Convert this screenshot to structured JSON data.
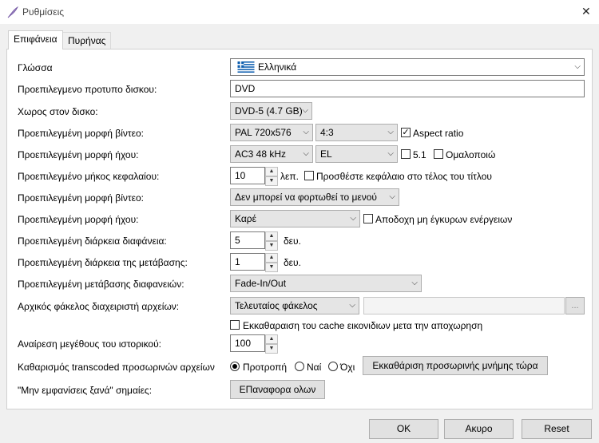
{
  "window": {
    "title": "Ρυθμίσεις",
    "close_label": "✕"
  },
  "tabs": [
    {
      "label": "Επιφάνεια"
    },
    {
      "label": "Πυρήνας"
    }
  ],
  "rows": {
    "language": {
      "label": "Γλώσσα",
      "value": "Ελληνικά"
    },
    "disc_template": {
      "label": "Προεπιλεγμενο προτυπο δισκου:",
      "value": "DVD"
    },
    "disc_space": {
      "label": "Χωρος στον δισκο:",
      "value": "DVD-5 (4.7 GB)"
    },
    "video_format": {
      "label": "Προεπιλεγμένη μορφή βίντεο:",
      "value": "PAL 720x576",
      "aspect_value": "4:3",
      "aspect_ratio_label": "Aspect ratio",
      "aspect_ratio_checked": true
    },
    "audio_format": {
      "label": "Προεπιλεγμένη μορφή ήχου:",
      "value": "AC3 48 kHz",
      "lang_value": "EL",
      "surround_label": "5.1",
      "normalize_label": "Ομαλοποιώ"
    },
    "chapter_length": {
      "label": "Προεπιλεγμένο μήκος κεφαλαίου:",
      "value": "10",
      "unit": "λεπ.",
      "add_chapter_label": "Προσθέστε κεφάλαιο στο τέλος του τίτλου"
    },
    "menu_video_format": {
      "label": "Προεπιλεγμένη μορφή βίντεο:",
      "value": "Δεν μπορεί να φορτωθεί το μενού"
    },
    "menu_audio_format": {
      "label": "Προεπιλεγμένη μορφή ήχου:",
      "value": "Καρέ",
      "accept_invalid_label": "Αποδοχη μη έγκυρων ενέργειων"
    },
    "slide_duration": {
      "label": "Προεπιλεγμένη διάρκεια διαφάνεια:",
      "value": "5",
      "unit": "δευ."
    },
    "transition_duration": {
      "label": "Προεπιλεγμένη διάρκεια της μετάβασης:",
      "value": "1",
      "unit": "δευ."
    },
    "slide_transition": {
      "label": "Προεπιλεγμένη μετάβασης διαφανειών:",
      "value": "Fade-In/Out"
    },
    "file_manager_folder": {
      "label": "Αρχικός φάκελος διαχειριστή αρχείων:",
      "value": "Τελευταίος φάκελος",
      "path_value": "",
      "browse_label": "..."
    },
    "clear_cache": {
      "label": "Εκκαθαραιση του cache εικονιδιων μετα την αποχωρηση"
    },
    "history_size": {
      "label": "Αναίρεση μεγέθους του ιστορικού:",
      "value": "100"
    },
    "transcoded_cleanup": {
      "label": "Καθαρισμός transcoded προσωρινών αρχείων",
      "options": [
        "Προτροπή",
        "Ναί",
        "Όχι"
      ],
      "selected": "Προτροπή",
      "clear_now_label": "Εκκαθάριση προσωρινής μνήμης τώρα"
    },
    "dont_show": {
      "label": "\"Μην εμφανίσεις ξανά\" σημαίες:",
      "reset_label": "ΕΠαναφορα ολων"
    }
  },
  "footer": {
    "ok_label": "OK",
    "cancel_label": "Ακυρο",
    "reset_label": "Reset"
  },
  "colors": {
    "flag_blue": "#0d5eaf",
    "flag_white": "#ffffff"
  }
}
